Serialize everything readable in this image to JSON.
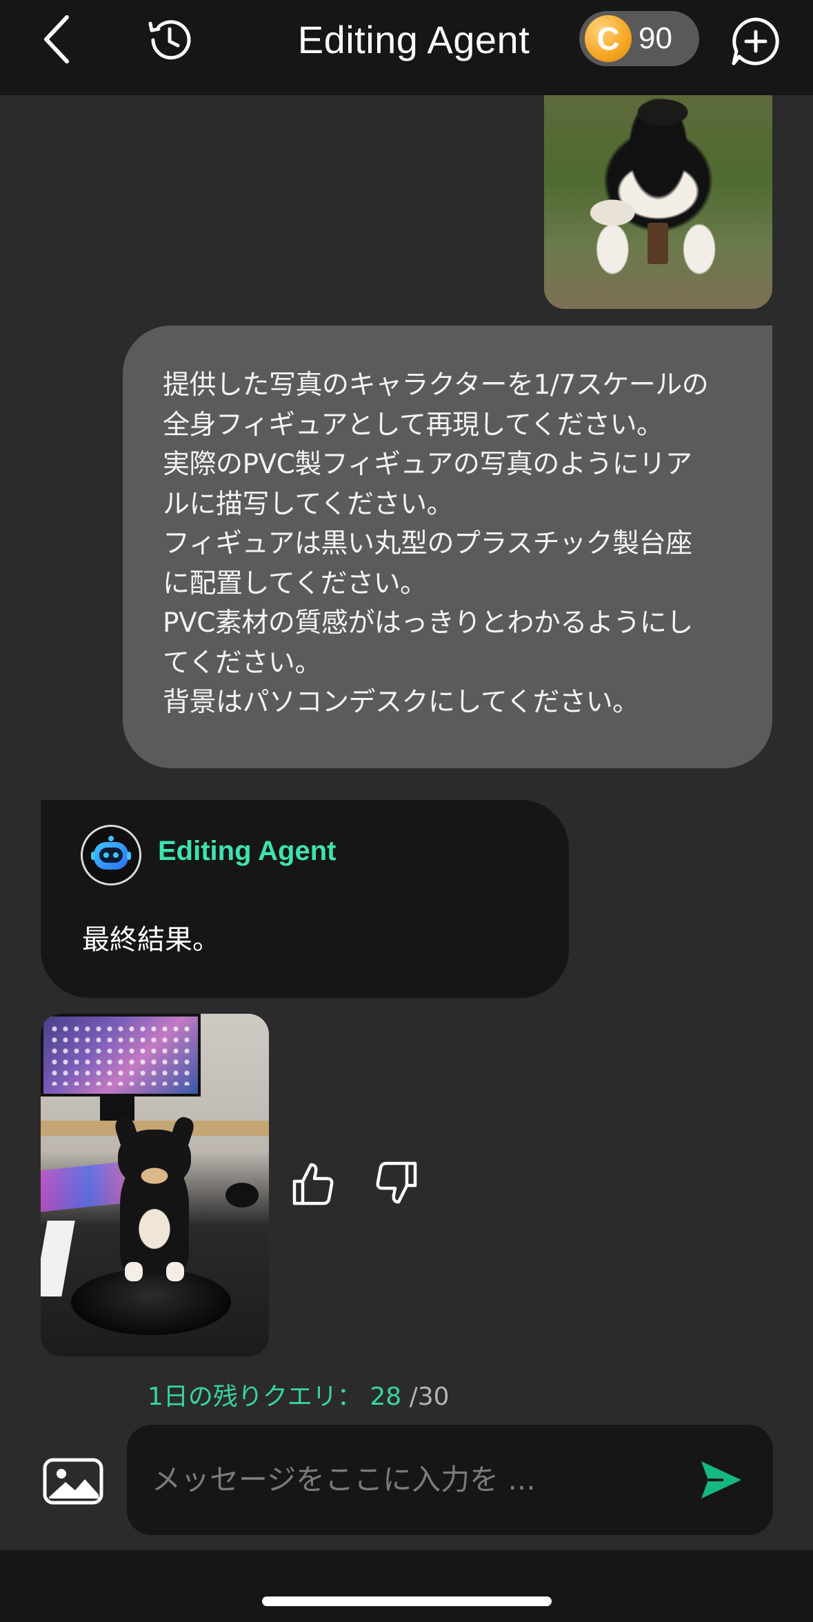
{
  "header": {
    "title": "Editing Agent",
    "coin_symbol": "C",
    "coin_count": "90",
    "icons": [
      "back-chevron-icon",
      "history-clock-icon",
      "new-chat-plus-icon"
    ]
  },
  "user_message": {
    "lines": [
      "提供した写真のキャラクターを1/7スケールの",
      "全身フィギュアとして再現してください。",
      "実際のPVC製フィギュアの写真のようにリア",
      "ルに描写してください。",
      "フィギュアは黒い丸型のプラスチック製台座",
      "に配置してください。",
      "PVC素材の質感がはっきりとわかるようにし",
      "てください。",
      "背景はパソコンデスクにしてください。"
    ]
  },
  "agent_message": {
    "name": "Editing Agent",
    "text": "最終結果。"
  },
  "feedback": {
    "icons": [
      "thumbs-up-icon",
      "thumbs-down-icon"
    ]
  },
  "quota": {
    "label": "1日の残りクエリ：",
    "remaining": "28",
    "total": "/30"
  },
  "composer": {
    "placeholder": "メッセージをここに入力を ..."
  },
  "colors": {
    "background": "#2b2b2b",
    "header": "#161616",
    "user_bubble": "#5b5b5b",
    "agent_bubble": "#161616",
    "accent": "#36d6a0",
    "send": "#13b97f",
    "coin": "#f5a623"
  }
}
